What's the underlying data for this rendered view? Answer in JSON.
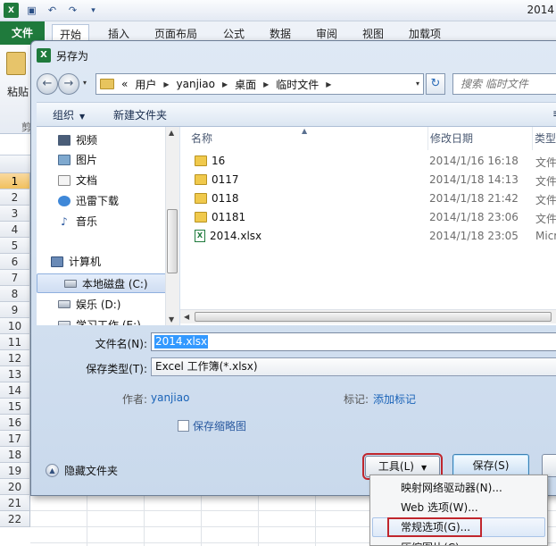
{
  "excel": {
    "title": "2014",
    "tabs": [
      "文件",
      "开始",
      "插入",
      "页面布局",
      "公式",
      "数据",
      "审阅",
      "视图",
      "加载项"
    ],
    "paste_label": "粘贴",
    "clipboard_label": "剪",
    "row_numbers": [
      "1",
      "2",
      "3",
      "4",
      "5",
      "6",
      "7",
      "8",
      "9",
      "10",
      "11",
      "12",
      "13",
      "14",
      "15",
      "16",
      "17",
      "18",
      "19",
      "20",
      "21",
      "22"
    ],
    "qat_icons": [
      "excel-icon",
      "save-icon",
      "undo-icon",
      "redo-icon",
      "customize-icon"
    ]
  },
  "dialog": {
    "title": "另存为",
    "address": [
      "用户",
      "yanjiao",
      "桌面",
      "临时文件"
    ],
    "address_prefix": "«",
    "search_placeholder": "搜索 临时文件",
    "toolbar": {
      "organize": "组织",
      "new_folder": "新建文件夹"
    },
    "nav_items": [
      "视频",
      "图片",
      "文档",
      "迅雷下载",
      "音乐",
      "计算机",
      "本地磁盘 (C:)",
      "娱乐 (D:)",
      "学习工作 (E:)"
    ],
    "columns": {
      "name": "名称",
      "date": "修改日期",
      "type": "类型"
    },
    "files": [
      {
        "name": "16",
        "date": "2014/1/16 16:18",
        "type": "文件",
        "kind": "folder"
      },
      {
        "name": "0117",
        "date": "2014/1/18 14:13",
        "type": "文件",
        "kind": "folder"
      },
      {
        "name": "0118",
        "date": "2014/1/18 21:42",
        "type": "文件",
        "kind": "folder"
      },
      {
        "name": "01181",
        "date": "2014/1/18 23:06",
        "type": "文件",
        "kind": "folder"
      },
      {
        "name": "2014.xlsx",
        "date": "2014/1/18 23:05",
        "type": "Micr",
        "kind": "xlsx"
      }
    ],
    "filename_label": "文件名(N):",
    "filename_value": "2014.xlsx",
    "filetype_label": "保存类型(T):",
    "filetype_value": "Excel 工作簿(*.xlsx)",
    "author_label": "作者:",
    "author_value": "yanjiao",
    "tags_label": "标记:",
    "tags_value": "添加标记",
    "thumbnail_label": "保存缩略图",
    "hide_folders": "隐藏文件夹",
    "tools_button": "工具(L)",
    "save_button": "保存(S)"
  },
  "tools_menu": {
    "items": [
      "映射网络驱动器(N)...",
      "Web 选项(W)...",
      "常规选项(G)...",
      "压缩图片(C)..."
    ],
    "highlighted_index": 2
  },
  "colors": {
    "excel_green": "#1f7a3c",
    "highlight_red": "#c0262d",
    "selection_blue": "#3399ff"
  }
}
